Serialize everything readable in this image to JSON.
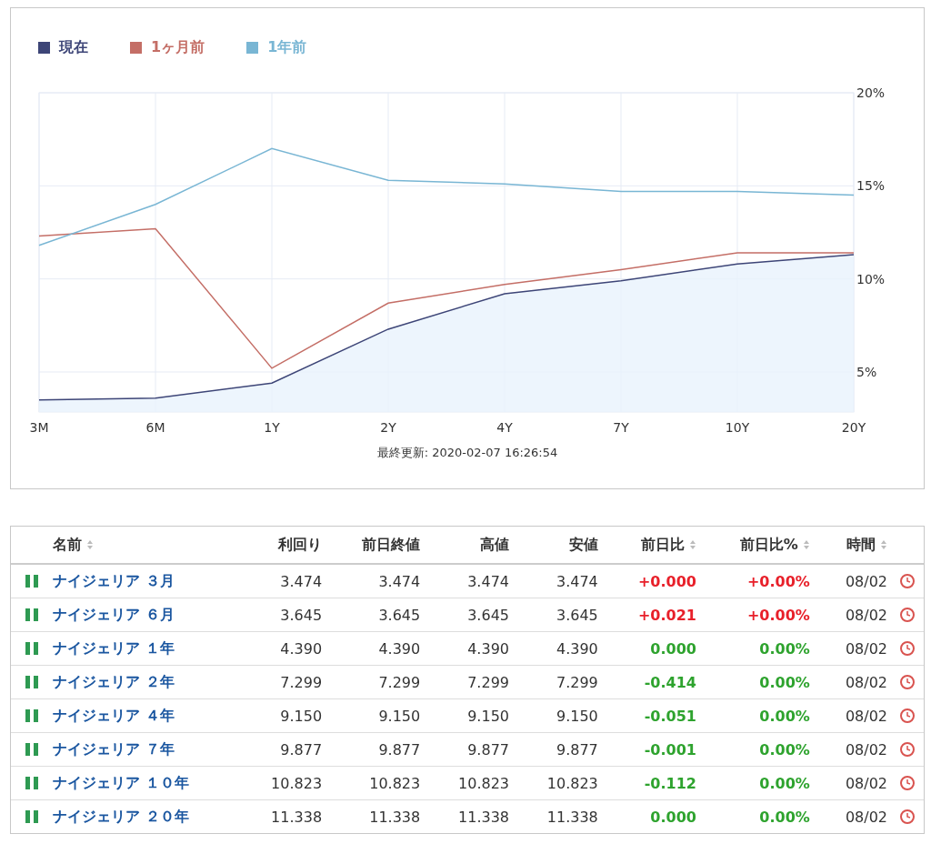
{
  "chart": {
    "chart_data": {
      "type": "line",
      "grid": true,
      "categories": [
        "3M",
        "6M",
        "1Y",
        "2Y",
        "4Y",
        "7Y",
        "10Y",
        "20Y"
      ],
      "ylim": [
        2.85,
        20
      ],
      "yticks": [
        {
          "value": 5,
          "label": "5%"
        },
        {
          "value": 10,
          "label": "10%"
        },
        {
          "value": 15,
          "label": "15%"
        },
        {
          "value": 20,
          "label": "20%"
        }
      ],
      "series": [
        {
          "name": "現在",
          "color": "#3d4577",
          "values": [
            3.5,
            3.6,
            4.4,
            7.3,
            9.2,
            9.9,
            10.8,
            11.3
          ]
        },
        {
          "name": "1ヶ月前",
          "color": "#c46e66",
          "values": [
            12.3,
            12.7,
            5.2,
            8.7,
            9.7,
            10.5,
            11.4,
            11.4
          ]
        },
        {
          "name": "1年前",
          "color": "#79b6d4",
          "values": [
            11.8,
            14.0,
            17.0,
            15.3,
            15.1,
            14.7,
            14.7,
            14.5
          ]
        }
      ]
    },
    "updated": "最終更新: 2020-02-07 16:26:54"
  },
  "table": {
    "columns": [
      {
        "label": "名前",
        "sortable": true
      },
      {
        "label": "利回り",
        "sortable": false
      },
      {
        "label": "前日終値",
        "sortable": false
      },
      {
        "label": "高値",
        "sortable": false
      },
      {
        "label": "安値",
        "sortable": false
      },
      {
        "label": "前日比",
        "sortable": true
      },
      {
        "label": "前日比%",
        "sortable": true
      },
      {
        "label": "時間",
        "sortable": true
      }
    ],
    "rows": [
      {
        "name": "ナイジェリア ３月",
        "yield": "3.474",
        "prev": "3.474",
        "high": "3.474",
        "low": "3.474",
        "change": "+0.000",
        "change_pct": "+0.00%",
        "up": true,
        "time": "08/02"
      },
      {
        "name": "ナイジェリア ６月",
        "yield": "3.645",
        "prev": "3.645",
        "high": "3.645",
        "low": "3.645",
        "change": "+0.021",
        "change_pct": "+0.00%",
        "up": true,
        "time": "08/02"
      },
      {
        "name": "ナイジェリア １年",
        "yield": "4.390",
        "prev": "4.390",
        "high": "4.390",
        "low": "4.390",
        "change": "0.000",
        "change_pct": "0.00%",
        "up": false,
        "time": "08/02"
      },
      {
        "name": "ナイジェリア ２年",
        "yield": "7.299",
        "prev": "7.299",
        "high": "7.299",
        "low": "7.299",
        "change": "-0.414",
        "change_pct": "0.00%",
        "up": false,
        "time": "08/02"
      },
      {
        "name": "ナイジェリア ４年",
        "yield": "9.150",
        "prev": "9.150",
        "high": "9.150",
        "low": "9.150",
        "change": "-0.051",
        "change_pct": "0.00%",
        "up": false,
        "time": "08/02"
      },
      {
        "name": "ナイジェリア ７年",
        "yield": "9.877",
        "prev": "9.877",
        "high": "9.877",
        "low": "9.877",
        "change": "-0.001",
        "change_pct": "0.00%",
        "up": false,
        "time": "08/02"
      },
      {
        "name": "ナイジェリア １０年",
        "yield": "10.823",
        "prev": "10.823",
        "high": "10.823",
        "low": "10.823",
        "change": "-0.112",
        "change_pct": "0.00%",
        "up": false,
        "time": "08/02"
      },
      {
        "name": "ナイジェリア ２０年",
        "yield": "11.338",
        "prev": "11.338",
        "high": "11.338",
        "low": "11.338",
        "change": "0.000",
        "change_pct": "0.00%",
        "up": false,
        "time": "08/02"
      }
    ]
  }
}
